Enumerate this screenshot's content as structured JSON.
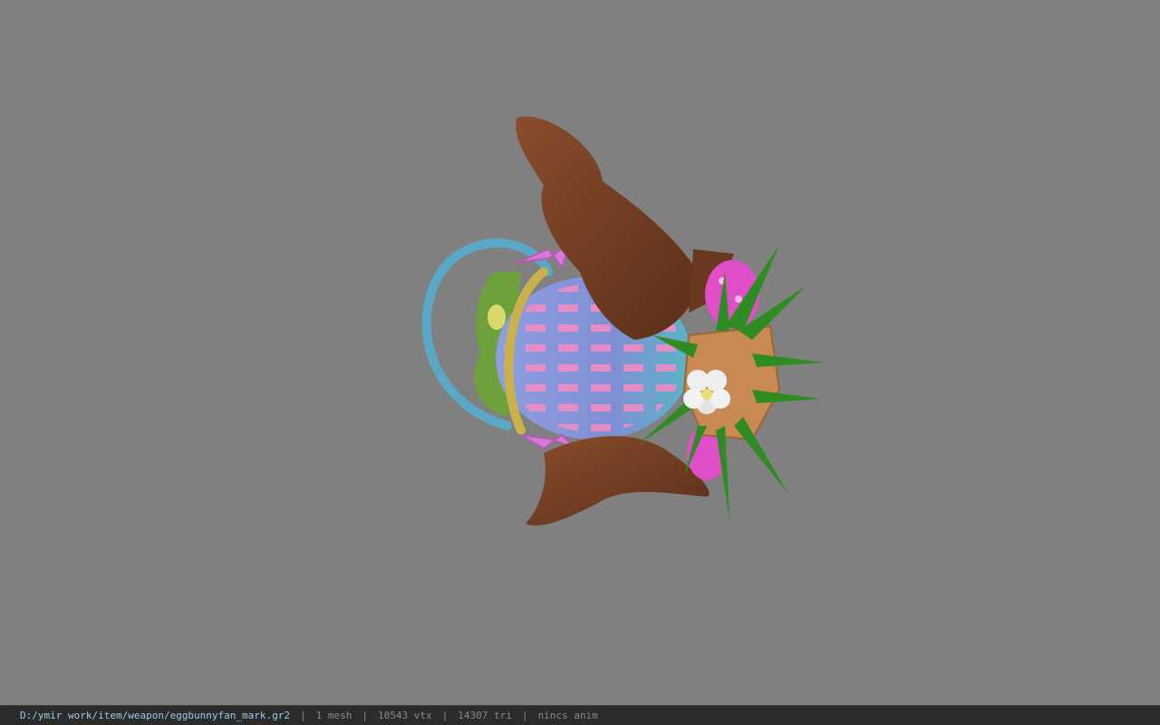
{
  "window": {
    "background": "#808080"
  },
  "viewport": {
    "model_icon": "easter-basket-bunny-model"
  },
  "statusbar": {
    "path": "D:/ymir work/item/weapon/eggbunnyfan_mark.gr2",
    "sep": "|",
    "mesh": "1 mesh",
    "vtx": "10543 vtx",
    "tri": "14307 tri",
    "anim": "nincs anim",
    "path_color": "#9ec9e6",
    "text_color": "#8a8a8a"
  }
}
